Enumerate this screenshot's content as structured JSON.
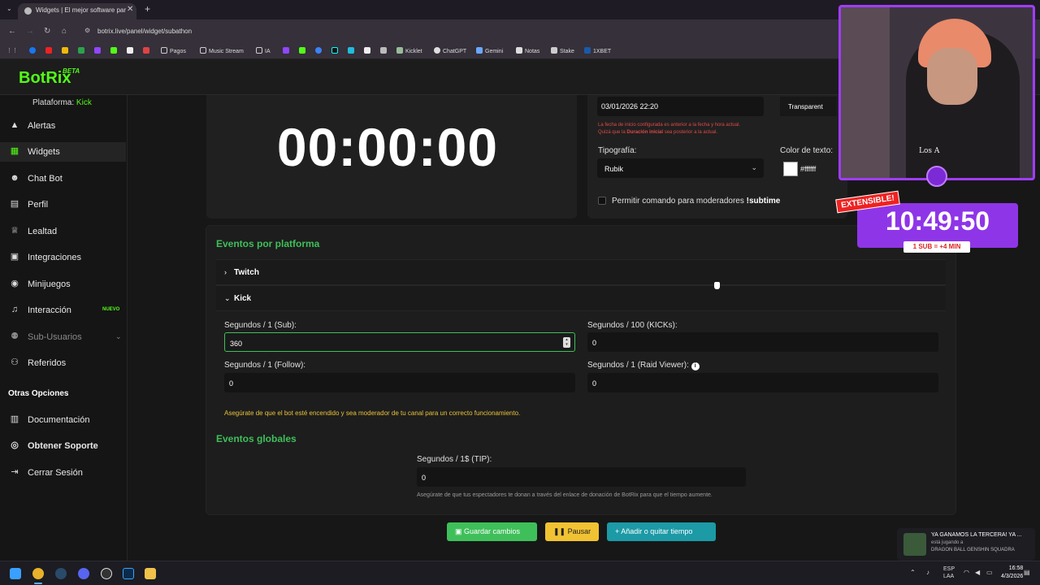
{
  "browser": {
    "tab_title": "Widgets | El mejor software par",
    "url": "botrix.live/panel/widget/subathon",
    "bookmarks": [
      "Pagos",
      "Music Stream",
      "IA",
      "Kicklet",
      "ChatGPT",
      "Gemini",
      "Notas",
      "Stake",
      "1XBET"
    ]
  },
  "app": {
    "logo": "BotRix",
    "logo_badge": "BETA",
    "platform_label": "Plataforma:",
    "platform_value": "Kick"
  },
  "sidebar": {
    "items": [
      {
        "label": "Alertas",
        "icon": "warning-icon"
      },
      {
        "label": "Widgets",
        "icon": "widgets-icon"
      },
      {
        "label": "Chat Bot",
        "icon": "robot-icon"
      },
      {
        "label": "Perfil",
        "icon": "profile-icon"
      },
      {
        "label": "Lealtad",
        "icon": "trophy-icon"
      },
      {
        "label": "Integraciones",
        "icon": "integrations-icon"
      },
      {
        "label": "Minijuegos",
        "icon": "gamepad-icon"
      },
      {
        "label": "Interacción",
        "icon": "music-icon",
        "badge": "NUEVO"
      },
      {
        "label": "Sub-Usuarios",
        "icon": "users-icon"
      },
      {
        "label": "Referidos",
        "icon": "referrals-icon"
      }
    ],
    "other_title": "Otras Opciones",
    "other_items": [
      {
        "label": "Documentación",
        "icon": "doc-icon"
      },
      {
        "label": "Obtener Soporte",
        "icon": "support-icon"
      },
      {
        "label": "Cerrar Sesión",
        "icon": "logout-icon"
      }
    ]
  },
  "timer": {
    "display": "00:00:00"
  },
  "settings": {
    "start_date": "03/01/2026 22:20",
    "bg_button": "Transparent",
    "warning_1": "La fecha de inicio configurada es anterior a la fecha y hora actual.",
    "warning_2_pre": "Quizá que la ",
    "warning_2_bold": "Duración inicial",
    "warning_2_post": " sea posterior a la actual.",
    "font_label": "Tipografía:",
    "font_value": "Rubik",
    "color_label": "Color de texto:",
    "color_value": "#ffffff",
    "mod_label": "Permitir comando para moderadores",
    "mod_command": "!subtime"
  },
  "events": {
    "title": "Eventos por platforma",
    "twitch": "Twitch",
    "kick": "Kick",
    "sub_label": "Segundos / 1 (Sub):",
    "sub_value": "360",
    "kicks_label": "Segundos / 100 (KICKs):",
    "kicks_value": "0",
    "follow_label": "Segundos / 1 (Follow):",
    "follow_value": "0",
    "raid_label": "Segundos / 1 (Raid Viewer):",
    "raid_value": "0",
    "note": "Asegúrate de que el bot esté encendido y sea moderador de tu canal para un correcto funcionamiento.",
    "global_title": "Eventos globales",
    "tip_label": "Segundos / 1$ (TIP):",
    "tip_value": "0",
    "tip_note": "Asegúrate de que tus espectadores te donan a través del enlace de donación de BotRix para que el tiempo aumente."
  },
  "buttons": {
    "save": "Guardar cambios",
    "pause": "Pausar",
    "add_time": "Añadir o quitar tiempo"
  },
  "overlay": {
    "extensible": "EXTENSIBLE!",
    "time": "10:49:50",
    "rate": "1 SUB = +4 MIN",
    "shirt_text": "Los A"
  },
  "notification": {
    "line1": "YA GANAMOS LA TERCERA! YA ...",
    "line2": "está jugando a",
    "line3": "DRAGON BALL GENSHIN SQUADRA"
  },
  "taskbar": {
    "lang1": "ESP",
    "lang2": "LAA",
    "time": "16:58",
    "date": "4/3/2026"
  },
  "colors": {
    "accent_green": "#53fc18",
    "title_green": "#3fbf5a",
    "overlay_purple": "#8f35e8",
    "warning_red": "#e04848",
    "note_yellow": "#e8c23a"
  }
}
